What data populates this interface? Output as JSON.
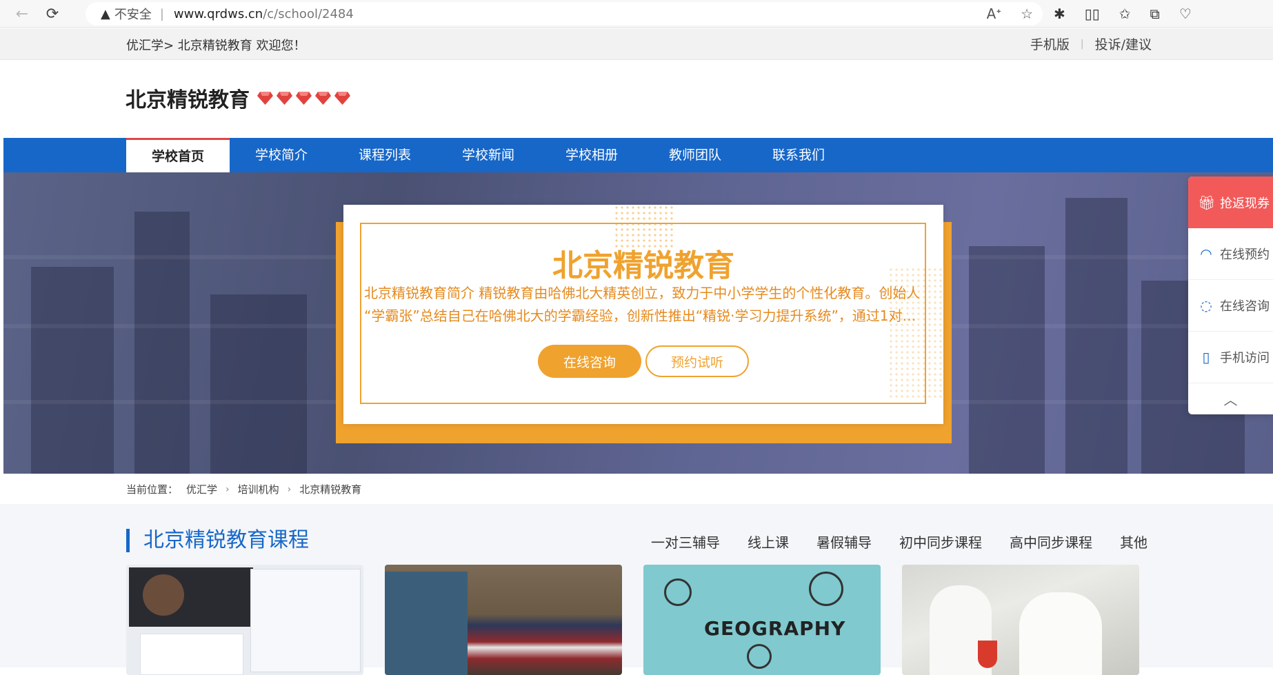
{
  "browser": {
    "back": "←",
    "reload": "⟳",
    "security_warning": "不安全",
    "url_host": "www.qrdws.cn",
    "url_path": "/c/school/2484"
  },
  "topbar": {
    "welcome": "优汇学> 北京精锐教育 欢迎您！",
    "mobile": "手机版",
    "feedback": "投诉/建议"
  },
  "header": {
    "school_name": "北京精锐教育",
    "gem_count": 5,
    "gem_color": "#e0433f"
  },
  "nav": {
    "items": [
      {
        "label": "学校首页",
        "active": true
      },
      {
        "label": "学校简介"
      },
      {
        "label": "课程列表"
      },
      {
        "label": "学校新闻"
      },
      {
        "label": "学校相册"
      },
      {
        "label": "教师团队"
      },
      {
        "label": "联系我们"
      }
    ]
  },
  "banner": {
    "title": "北京精锐教育",
    "line1": "北京精锐教育简介 精锐教育由哈佛北大精英创立，致力于中小学学生的个性化教育。创始人",
    "line2": "“学霸张”总结自己在哈佛北大的学霸经验，创新性推出“精锐·学习力提升系统”，通过1对1...",
    "consult_btn": "在线咨询",
    "trial_btn": "预约试听",
    "accent_color": "#f0a22e"
  },
  "breadcrumb": {
    "prefix": "当前位置：",
    "items": [
      "优汇学",
      "培训机构",
      "北京精锐教育"
    ]
  },
  "courses": {
    "title": "北京精锐教育课程",
    "tabs": [
      "一对三辅导",
      "线上课",
      "暑假辅导",
      "初中同步课程",
      "高中同步课程",
      "其他"
    ],
    "thumb3_text": "GEOGRAPHY"
  },
  "float_panel": {
    "items": [
      {
        "label": "抢返现券",
        "icon": "gift-icon"
      },
      {
        "label": "在线预约",
        "icon": "headset-icon"
      },
      {
        "label": "在线咨询",
        "icon": "chat-icon"
      },
      {
        "label": "手机访问",
        "icon": "phone-icon"
      }
    ],
    "up": "︿"
  },
  "colors": {
    "nav_blue": "#1767c9",
    "hot_red": "#f25a5a"
  }
}
